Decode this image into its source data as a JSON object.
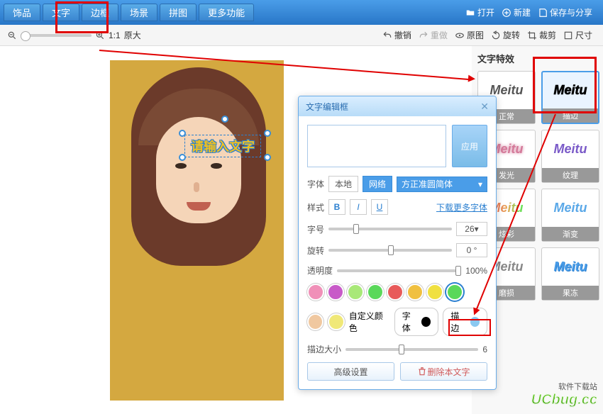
{
  "tabs": [
    "饰品",
    "文字",
    "边框",
    "场景",
    "拼图",
    "更多功能"
  ],
  "top_right": {
    "open": "打开",
    "new": "新建",
    "save": "保存与分享"
  },
  "sub": {
    "ratio": "1:1",
    "zoom_label": "原大",
    "undo": "撤销",
    "redo": "重做",
    "original": "原图",
    "rotate": "旋转",
    "crop": "裁剪",
    "size": "尺寸"
  },
  "placeholder": "请输入文字",
  "effects": {
    "title": "文字特效",
    "items": [
      {
        "id": "normal",
        "label": "正常",
        "preview": "Meitu"
      },
      {
        "id": "stroke",
        "label": "描边",
        "preview": "Meitu"
      },
      {
        "id": "glow",
        "label": "发光",
        "preview": "Meitu"
      },
      {
        "id": "texture",
        "label": "纹理",
        "preview": "Meitu"
      },
      {
        "id": "rainbow",
        "label": "炫彩",
        "preview": "Meitu"
      },
      {
        "id": "grad",
        "label": "渐变",
        "preview": "Meitu"
      },
      {
        "id": "wear",
        "label": "磨损",
        "preview": "Meitu"
      },
      {
        "id": "jelly",
        "label": "果冻",
        "preview": "Meitu"
      }
    ]
  },
  "dialog": {
    "title": "文字编辑框",
    "apply": "应用",
    "font_label": "字体",
    "font_src_local": "本地",
    "font_src_net": "网络",
    "font_name": "方正准圆简体",
    "style_label": "样式",
    "bold": "B",
    "italic": "I",
    "underline": "U",
    "more_fonts": "下载更多字体",
    "size_label": "字号",
    "size_value": "26",
    "rotate_label": "旋转",
    "rotate_value": "0",
    "opacity_label": "透明度",
    "opacity_value": "100%",
    "colors": [
      "#f090b8",
      "#c85ac8",
      "#a8e878",
      "#5ad85a",
      "#e85a5a",
      "#f0c040",
      "#f0e040",
      "#5ad85a"
    ],
    "custom_colors": [
      "#f0c8a0",
      "#f0e878"
    ],
    "custom_label": "自定义颜色",
    "fill_label": "字体",
    "fill_color": "#000000",
    "stroke_label": "描边",
    "stroke_color": "#8ac8f0",
    "stroke_size_label": "描边大小",
    "stroke_size_value": "6",
    "advanced": "高级设置",
    "delete": "删除本文字"
  },
  "watermark": {
    "line1": "软件下载站",
    "line2": "UCbug.cc"
  }
}
